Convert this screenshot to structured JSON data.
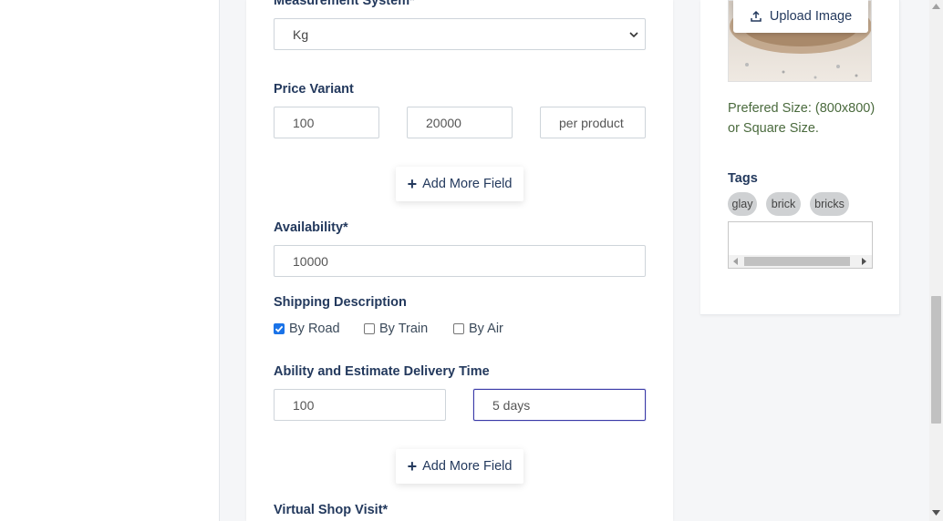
{
  "form": {
    "measurement_label": "Measurement System*",
    "measurement_value": "Kg",
    "price_variant_label": "Price Variant",
    "price_variant_values": [
      "100",
      "20000",
      "per product"
    ],
    "add_more_label": "Add More Field",
    "availability_label": "Availability*",
    "availability_value": "10000",
    "shipping_label": "Shipping Description",
    "shipping_options": [
      {
        "label": "By Road",
        "checked": true
      },
      {
        "label": "By Train",
        "checked": false
      },
      {
        "label": "By Air",
        "checked": false
      }
    ],
    "delivery_label": "Ability and Estimate Delivery Time",
    "delivery_values": [
      "100",
      "5 days"
    ],
    "add_more_label_2": "Add More Field",
    "virtual_label": "Virtual Shop Visit*"
  },
  "sidebar": {
    "upload_label": "Upload Image",
    "preferred_size": "Prefered Size: (800x800) or Square Size.",
    "tags_label": "Tags",
    "tags": [
      "glay",
      "brick",
      "bricks"
    ]
  },
  "colors": {
    "accent": "#23395d",
    "focus_border": "#3a3aa8",
    "checkbox_checked": "#1a73e8"
  }
}
